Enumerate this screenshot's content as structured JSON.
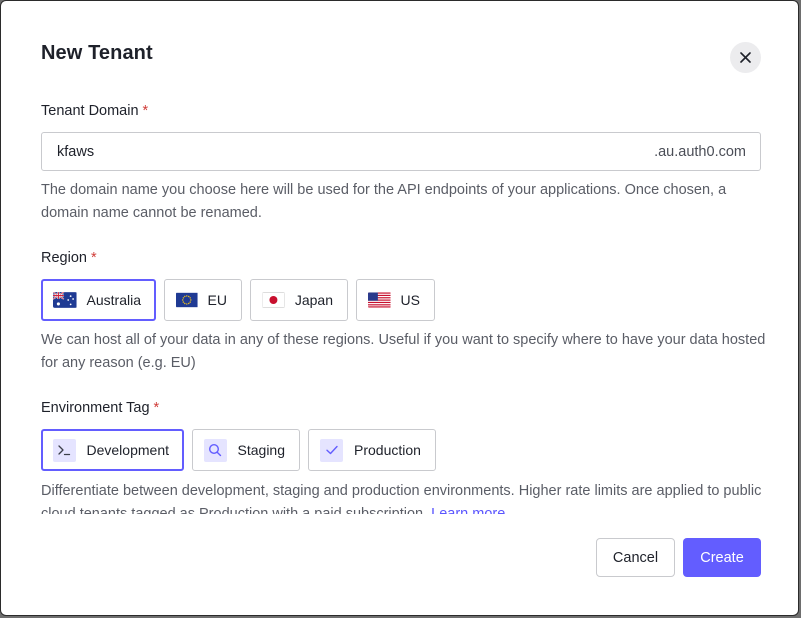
{
  "dialog": {
    "title": "New Tenant"
  },
  "tenant_domain": {
    "label": "Tenant Domain",
    "required_mark": "*",
    "value": "kfaws",
    "suffix": ".au.auth0.com",
    "help": "The domain name you choose here will be used for the API endpoints of your applications. Once chosen, a domain name cannot be renamed."
  },
  "region": {
    "label": "Region",
    "required_mark": "*",
    "options": [
      {
        "label": "Australia",
        "flag": "australia-flag-icon",
        "selected": true
      },
      {
        "label": "EU",
        "flag": "eu-flag-icon",
        "selected": false
      },
      {
        "label": "Japan",
        "flag": "japan-flag-icon",
        "selected": false
      },
      {
        "label": "US",
        "flag": "us-flag-icon",
        "selected": false
      }
    ],
    "help": "We can host all of your data in any of these regions. Useful if you want to specify where to have your data hosted for any reason (e.g. EU)"
  },
  "environment": {
    "label": "Environment Tag",
    "required_mark": "*",
    "options": [
      {
        "label": "Development",
        "icon": "terminal-icon",
        "selected": true
      },
      {
        "label": "Staging",
        "icon": "search-icon",
        "selected": false
      },
      {
        "label": "Production",
        "icon": "check-icon",
        "selected": false
      }
    ],
    "help": "Differentiate between development, staging and production environments. Higher rate limits are applied to public cloud tenants tagged as Production with a paid subscription.",
    "learn_more": "Learn more"
  },
  "actions": {
    "cancel": "Cancel",
    "create": "Create"
  },
  "colors": {
    "accent": "#635dff",
    "required": "#d03c38",
    "text": "#1e212a",
    "muted": "#5a5d66"
  }
}
